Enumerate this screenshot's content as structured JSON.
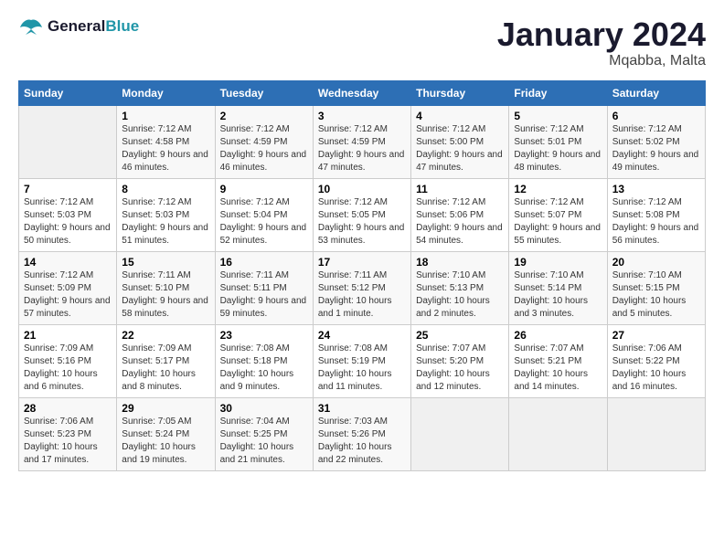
{
  "header": {
    "logo_line1": "General",
    "logo_line2": "Blue",
    "month_year": "January 2024",
    "location": "Mqabba, Malta"
  },
  "weekdays": [
    "Sunday",
    "Monday",
    "Tuesday",
    "Wednesday",
    "Thursday",
    "Friday",
    "Saturday"
  ],
  "weeks": [
    [
      {
        "day": "",
        "sunrise": "",
        "sunset": "",
        "daylight": ""
      },
      {
        "day": "1",
        "sunrise": "Sunrise: 7:12 AM",
        "sunset": "Sunset: 4:58 PM",
        "daylight": "Daylight: 9 hours and 46 minutes."
      },
      {
        "day": "2",
        "sunrise": "Sunrise: 7:12 AM",
        "sunset": "Sunset: 4:59 PM",
        "daylight": "Daylight: 9 hours and 46 minutes."
      },
      {
        "day": "3",
        "sunrise": "Sunrise: 7:12 AM",
        "sunset": "Sunset: 4:59 PM",
        "daylight": "Daylight: 9 hours and 47 minutes."
      },
      {
        "day": "4",
        "sunrise": "Sunrise: 7:12 AM",
        "sunset": "Sunset: 5:00 PM",
        "daylight": "Daylight: 9 hours and 47 minutes."
      },
      {
        "day": "5",
        "sunrise": "Sunrise: 7:12 AM",
        "sunset": "Sunset: 5:01 PM",
        "daylight": "Daylight: 9 hours and 48 minutes."
      },
      {
        "day": "6",
        "sunrise": "Sunrise: 7:12 AM",
        "sunset": "Sunset: 5:02 PM",
        "daylight": "Daylight: 9 hours and 49 minutes."
      }
    ],
    [
      {
        "day": "7",
        "sunrise": "Sunrise: 7:12 AM",
        "sunset": "Sunset: 5:03 PM",
        "daylight": "Daylight: 9 hours and 50 minutes."
      },
      {
        "day": "8",
        "sunrise": "Sunrise: 7:12 AM",
        "sunset": "Sunset: 5:03 PM",
        "daylight": "Daylight: 9 hours and 51 minutes."
      },
      {
        "day": "9",
        "sunrise": "Sunrise: 7:12 AM",
        "sunset": "Sunset: 5:04 PM",
        "daylight": "Daylight: 9 hours and 52 minutes."
      },
      {
        "day": "10",
        "sunrise": "Sunrise: 7:12 AM",
        "sunset": "Sunset: 5:05 PM",
        "daylight": "Daylight: 9 hours and 53 minutes."
      },
      {
        "day": "11",
        "sunrise": "Sunrise: 7:12 AM",
        "sunset": "Sunset: 5:06 PM",
        "daylight": "Daylight: 9 hours and 54 minutes."
      },
      {
        "day": "12",
        "sunrise": "Sunrise: 7:12 AM",
        "sunset": "Sunset: 5:07 PM",
        "daylight": "Daylight: 9 hours and 55 minutes."
      },
      {
        "day": "13",
        "sunrise": "Sunrise: 7:12 AM",
        "sunset": "Sunset: 5:08 PM",
        "daylight": "Daylight: 9 hours and 56 minutes."
      }
    ],
    [
      {
        "day": "14",
        "sunrise": "Sunrise: 7:12 AM",
        "sunset": "Sunset: 5:09 PM",
        "daylight": "Daylight: 9 hours and 57 minutes."
      },
      {
        "day": "15",
        "sunrise": "Sunrise: 7:11 AM",
        "sunset": "Sunset: 5:10 PM",
        "daylight": "Daylight: 9 hours and 58 minutes."
      },
      {
        "day": "16",
        "sunrise": "Sunrise: 7:11 AM",
        "sunset": "Sunset: 5:11 PM",
        "daylight": "Daylight: 9 hours and 59 minutes."
      },
      {
        "day": "17",
        "sunrise": "Sunrise: 7:11 AM",
        "sunset": "Sunset: 5:12 PM",
        "daylight": "Daylight: 10 hours and 1 minute."
      },
      {
        "day": "18",
        "sunrise": "Sunrise: 7:10 AM",
        "sunset": "Sunset: 5:13 PM",
        "daylight": "Daylight: 10 hours and 2 minutes."
      },
      {
        "day": "19",
        "sunrise": "Sunrise: 7:10 AM",
        "sunset": "Sunset: 5:14 PM",
        "daylight": "Daylight: 10 hours and 3 minutes."
      },
      {
        "day": "20",
        "sunrise": "Sunrise: 7:10 AM",
        "sunset": "Sunset: 5:15 PM",
        "daylight": "Daylight: 10 hours and 5 minutes."
      }
    ],
    [
      {
        "day": "21",
        "sunrise": "Sunrise: 7:09 AM",
        "sunset": "Sunset: 5:16 PM",
        "daylight": "Daylight: 10 hours and 6 minutes."
      },
      {
        "day": "22",
        "sunrise": "Sunrise: 7:09 AM",
        "sunset": "Sunset: 5:17 PM",
        "daylight": "Daylight: 10 hours and 8 minutes."
      },
      {
        "day": "23",
        "sunrise": "Sunrise: 7:08 AM",
        "sunset": "Sunset: 5:18 PM",
        "daylight": "Daylight: 10 hours and 9 minutes."
      },
      {
        "day": "24",
        "sunrise": "Sunrise: 7:08 AM",
        "sunset": "Sunset: 5:19 PM",
        "daylight": "Daylight: 10 hours and 11 minutes."
      },
      {
        "day": "25",
        "sunrise": "Sunrise: 7:07 AM",
        "sunset": "Sunset: 5:20 PM",
        "daylight": "Daylight: 10 hours and 12 minutes."
      },
      {
        "day": "26",
        "sunrise": "Sunrise: 7:07 AM",
        "sunset": "Sunset: 5:21 PM",
        "daylight": "Daylight: 10 hours and 14 minutes."
      },
      {
        "day": "27",
        "sunrise": "Sunrise: 7:06 AM",
        "sunset": "Sunset: 5:22 PM",
        "daylight": "Daylight: 10 hours and 16 minutes."
      }
    ],
    [
      {
        "day": "28",
        "sunrise": "Sunrise: 7:06 AM",
        "sunset": "Sunset: 5:23 PM",
        "daylight": "Daylight: 10 hours and 17 minutes."
      },
      {
        "day": "29",
        "sunrise": "Sunrise: 7:05 AM",
        "sunset": "Sunset: 5:24 PM",
        "daylight": "Daylight: 10 hours and 19 minutes."
      },
      {
        "day": "30",
        "sunrise": "Sunrise: 7:04 AM",
        "sunset": "Sunset: 5:25 PM",
        "daylight": "Daylight: 10 hours and 21 minutes."
      },
      {
        "day": "31",
        "sunrise": "Sunrise: 7:03 AM",
        "sunset": "Sunset: 5:26 PM",
        "daylight": "Daylight: 10 hours and 22 minutes."
      },
      {
        "day": "",
        "sunrise": "",
        "sunset": "",
        "daylight": ""
      },
      {
        "day": "",
        "sunrise": "",
        "sunset": "",
        "daylight": ""
      },
      {
        "day": "",
        "sunrise": "",
        "sunset": "",
        "daylight": ""
      }
    ]
  ]
}
